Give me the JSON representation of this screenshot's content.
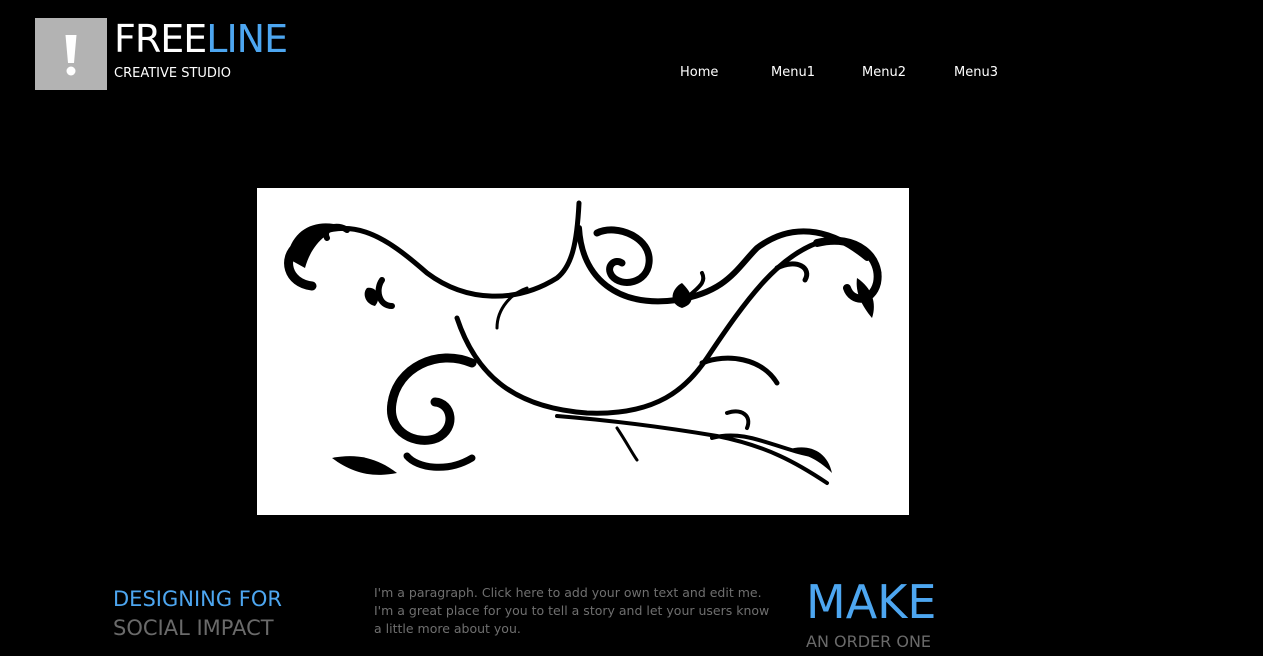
{
  "brand": {
    "name_part1": "FREE",
    "name_part2": "LINE",
    "tagline": "CREATIVE STUDIO",
    "logo_icon": "exclamation-icon",
    "accent_color": "#4da6f0"
  },
  "nav": {
    "items": [
      {
        "label": "Home"
      },
      {
        "label": "Menu1"
      },
      {
        "label": "Menu2"
      },
      {
        "label": "Menu3"
      }
    ]
  },
  "hero": {
    "image": "black-floral-swirl-ornament"
  },
  "content": {
    "heading_line1": "DESIGNING FOR",
    "heading_line2": "SOCIAL IMPACT",
    "paragraph": "I'm a paragraph. Click here to add your own text and edit me. I'm a great place for you to tell a story and let your users know a little more about you.",
    "cta_big": "MAKE",
    "cta_small": "AN ORDER ONE"
  }
}
